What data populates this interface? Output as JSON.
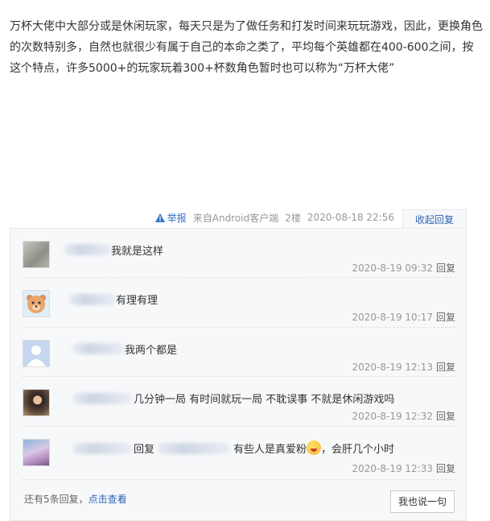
{
  "post": {
    "paragraph": "万杯大佬中大部分或是休闲玩家，每天只是为了做任务和打发时间来玩玩游戏，因此，更换角色的次数特别多，自然也就很少有属于自己的本命之类了，平均每个英雄都在400-600之间，按这个特点，许多5000+的玩家玩着300+杯数角色暂时也可以称为“万杯大佬”"
  },
  "meta": {
    "report_label": "举报",
    "source": "来自Android客户端",
    "floor": "2楼",
    "time": "2020-08-18 22:56",
    "collapse_label": "收起回复"
  },
  "replies": [
    {
      "text": "我就是这样",
      "time": "2020-8-19 09:32",
      "reply_label": "回复",
      "avatar": "gray-photo"
    },
    {
      "text": "有理有理",
      "time": "2020-8-19 10:17",
      "reply_label": "回复",
      "avatar": "cartoon-bear"
    },
    {
      "text": "我两个都是",
      "time": "2020-8-19 12:13",
      "reply_label": "回复",
      "avatar": "default-silhouette"
    },
    {
      "text": "几分钟一局 有时间就玩一局 不耽误事 不就是休闲游戏吗",
      "time": "2020-8-19 12:32",
      "reply_label": "回复",
      "avatar": "dark-anime"
    },
    {
      "text_prefix": "回复",
      "text_suffix": "有些人是真爱粉",
      "text_tail": "，会肝几个小时",
      "time": "2020-8-19 12:33",
      "reply_label": "回复",
      "avatar": "anime-girl",
      "emoji": "grin-emoji"
    }
  ],
  "footer": {
    "more_prefix": "还有5条回复，",
    "more_link": "点击查看",
    "say_button": "我也说一句"
  }
}
